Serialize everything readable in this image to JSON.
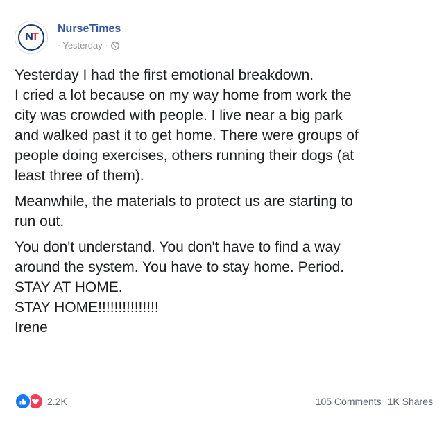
{
  "page": {
    "name": "NurseTimes",
    "timestamp": "Yesterday",
    "logo_text": "NT",
    "logo_letter_1": "N",
    "logo_letter_2": "T"
  },
  "post": {
    "paragraphs": [
      {
        "lines": [
          "Yesterday I had the first emotional breakdown.",
          "I cried a lot because on my way home from work the",
          "city was crowded with people. I live near a big park",
          "and walked past it to get home. There were groups of",
          "people doing exercises, others running their dogs (at",
          "least three of them)."
        ]
      },
      {
        "lines": [
          "Meanwhile, the materials to protect us are starting to",
          "run out."
        ]
      },
      {
        "lines": [
          "You don't understand. You don't have to find a way",
          "around the system. You have to stay home. Period.",
          "STAY AT HOME.",
          "STAY HOME!!!!!!!!!!!!!!!",
          "Irene"
        ]
      }
    ]
  },
  "footer": {
    "reaction_count": "2.2K",
    "comments": "105 Comments",
    "shares": "1K Shares"
  },
  "colors": {
    "page_name": "#365899",
    "meta_text": "#90949c",
    "body_text": "#1c1e21",
    "like": "#1877f2",
    "love": "#f33e58",
    "logo_navy": "#1d3b6e",
    "logo_red": "#d7263d"
  },
  "icons": {
    "audience": "globe-icon",
    "reaction_1": "like-icon",
    "reaction_2": "love-icon"
  }
}
